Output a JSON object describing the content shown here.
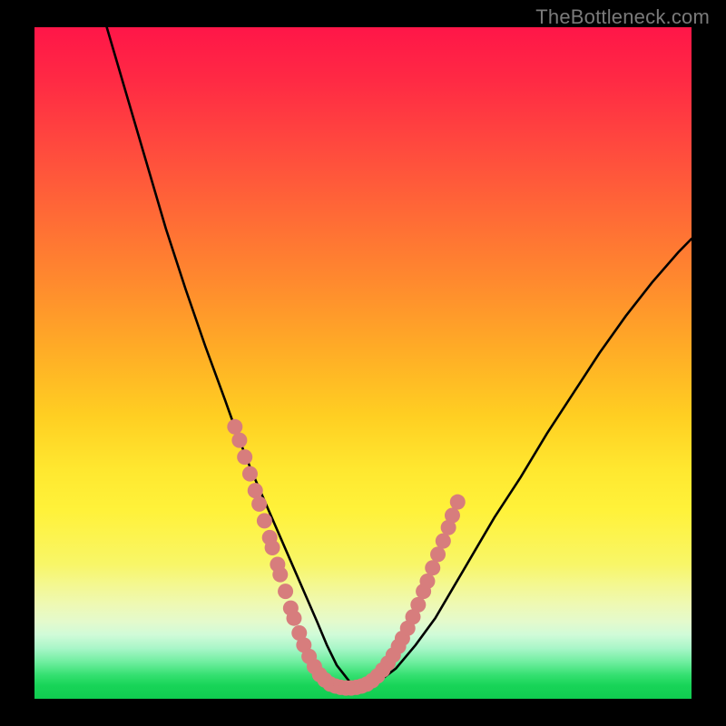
{
  "watermark": "TheBottleneck.com",
  "colors": {
    "frame": "#000000",
    "curve": "#000000",
    "point_fill": "#d77d7d",
    "point_stroke": "#c06a6a"
  },
  "chart_data": {
    "type": "line",
    "title": "",
    "xlabel": "",
    "ylabel": "",
    "xlim": [
      0,
      100
    ],
    "ylim": [
      0,
      100
    ],
    "note": "No axes, ticks, or numeric labels are visible in the image. The curve is a stylized V shape reaching a minimum near the lower green band; x/y below are normalized 0–100 within the plot box, estimated from the pixels.",
    "series": [
      {
        "name": "bottleneck-curve",
        "x": [
          11,
          14,
          17,
          20,
          23,
          26,
          29,
          31,
          33,
          35,
          37,
          39,
          41,
          43,
          44.5,
          46,
          48,
          50,
          52,
          55,
          58,
          61,
          64,
          67,
          70,
          74,
          78,
          82,
          86,
          90,
          94,
          98,
          100
        ],
        "y": [
          100,
          90,
          80,
          70,
          61,
          52.5,
          44.5,
          39,
          34,
          29.5,
          25,
          20.5,
          16,
          11.5,
          8,
          5,
          2.5,
          1.7,
          2.3,
          4.5,
          8,
          12,
          17,
          22,
          27,
          33,
          39.5,
          45.5,
          51.5,
          57,
          62,
          66.5,
          68.5
        ]
      }
    ],
    "highlight_points": {
      "name": "pink-dots",
      "note": "Two clusters of salmon-pink dots along the curve near the bottom of the V, left side slightly above the trough and right side climbing out.",
      "points": [
        {
          "x": 30.5,
          "y": 40.5
        },
        {
          "x": 31.2,
          "y": 38.5
        },
        {
          "x": 32.0,
          "y": 36.0
        },
        {
          "x": 32.8,
          "y": 33.5
        },
        {
          "x": 33.6,
          "y": 31.0
        },
        {
          "x": 34.2,
          "y": 29.0
        },
        {
          "x": 35.0,
          "y": 26.5
        },
        {
          "x": 35.8,
          "y": 24.0
        },
        {
          "x": 36.2,
          "y": 22.5
        },
        {
          "x": 37.0,
          "y": 20.0
        },
        {
          "x": 37.4,
          "y": 18.5
        },
        {
          "x": 38.2,
          "y": 16.0
        },
        {
          "x": 39.0,
          "y": 13.5
        },
        {
          "x": 39.5,
          "y": 12.0
        },
        {
          "x": 40.3,
          "y": 9.8
        },
        {
          "x": 41.0,
          "y": 8.0
        },
        {
          "x": 41.8,
          "y": 6.3
        },
        {
          "x": 42.6,
          "y": 4.8
        },
        {
          "x": 43.4,
          "y": 3.6
        },
        {
          "x": 44.2,
          "y": 2.8
        },
        {
          "x": 45.0,
          "y": 2.2
        },
        {
          "x": 45.8,
          "y": 1.9
        },
        {
          "x": 46.6,
          "y": 1.7
        },
        {
          "x": 47.4,
          "y": 1.6
        },
        {
          "x": 48.2,
          "y": 1.6
        },
        {
          "x": 49.0,
          "y": 1.7
        },
        {
          "x": 49.8,
          "y": 1.9
        },
        {
          "x": 50.6,
          "y": 2.2
        },
        {
          "x": 51.4,
          "y": 2.7
        },
        {
          "x": 52.2,
          "y": 3.4
        },
        {
          "x": 53.0,
          "y": 4.3
        },
        {
          "x": 53.8,
          "y": 5.3
        },
        {
          "x": 54.6,
          "y": 6.5
        },
        {
          "x": 55.4,
          "y": 7.8
        },
        {
          "x": 56.0,
          "y": 9.0
        },
        {
          "x": 56.8,
          "y": 10.5
        },
        {
          "x": 57.6,
          "y": 12.2
        },
        {
          "x": 58.4,
          "y": 14.0
        },
        {
          "x": 59.2,
          "y": 16.0
        },
        {
          "x": 59.8,
          "y": 17.5
        },
        {
          "x": 60.6,
          "y": 19.5
        },
        {
          "x": 61.4,
          "y": 21.5
        },
        {
          "x": 62.2,
          "y": 23.5
        },
        {
          "x": 63.0,
          "y": 25.5
        },
        {
          "x": 63.6,
          "y": 27.3
        },
        {
          "x": 64.4,
          "y": 29.3
        }
      ]
    }
  }
}
